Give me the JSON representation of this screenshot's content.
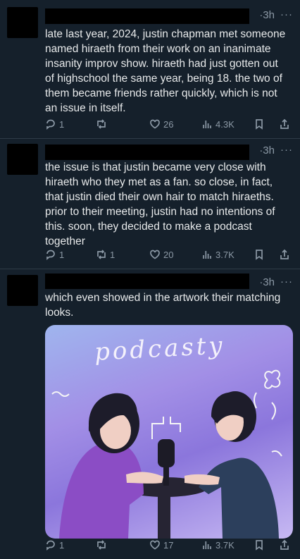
{
  "tweets": [
    {
      "time": "·3h",
      "more": "···",
      "text": "late last year, 2024, justin chapman met someone named hiraeth from their work on an inanimate insanity improv show. hiraeth had just gotten out of highschool the same year, being 18. the two of them became friends rather quickly, which is not an issue in itself.",
      "replies": "1",
      "retweets": "",
      "likes": "26",
      "views": "4.3K"
    },
    {
      "time": "·3h",
      "more": "···",
      "text": "the issue is that justin became very close with hiraeth who they met as a fan. so close, in fact, that justin died their own hair to match hiraeths. prior to their meeting, justin had no intentions of this. soon, they decided to make a podcast together",
      "replies": "1",
      "retweets": "1",
      "likes": "20",
      "views": "3.7K"
    },
    {
      "time": "·3h",
      "more": "···",
      "text": "which even showed in the artwork their matching looks.",
      "media_text": "podcasty",
      "replies": "1",
      "retweets": "",
      "likes": "17",
      "views": "3.7K"
    }
  ],
  "icons": [
    "reply-icon",
    "retweet-icon",
    "like-icon",
    "views-icon",
    "bookmark-icon",
    "share-icon"
  ],
  "colors": {
    "background": "#15202b",
    "text": "#e7e9ea",
    "muted": "#8b98a5"
  }
}
